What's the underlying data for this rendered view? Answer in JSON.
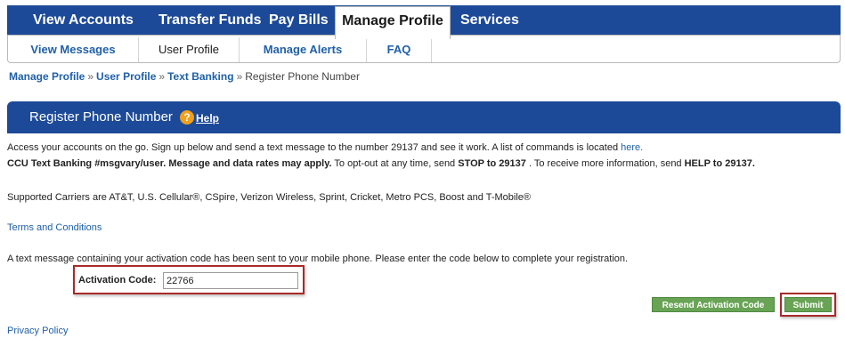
{
  "main_nav": {
    "tabs": [
      {
        "label": "View Accounts"
      },
      {
        "label": "Transfer Funds"
      },
      {
        "label": "Pay Bills"
      },
      {
        "label": "Manage Profile"
      },
      {
        "label": "Services"
      }
    ]
  },
  "sub_nav": {
    "items": [
      {
        "label": "View Messages"
      },
      {
        "label": "User Profile"
      },
      {
        "label": "Manage Alerts"
      },
      {
        "label": "FAQ"
      }
    ]
  },
  "breadcrumb": {
    "items": [
      "Manage Profile",
      "User Profile",
      "Text Banking"
    ],
    "separator": "»",
    "current": "Register Phone Number"
  },
  "panel": {
    "title": "Register Phone Number",
    "help_icon": "?",
    "help_label": "Help"
  },
  "intro": {
    "line1_text": "Access your accounts on the go. Sign up below and send a text message to the number 29137 and see it work. A list of commands is located",
    "line1_link": "here.",
    "line2_bold": "CCU Text Banking #msgvary/user. Message and data rates may apply.",
    "line2_a": " To opt-out at any time, send ",
    "line2_stop": "STOP to 29137",
    "line2_b": " . To receive more information, send ",
    "line2_help": "HELP to 29137."
  },
  "carriers_text": "Supported Carriers are AT&T, U.S. Cellular®, CSpire, Verizon Wireless, Sprint, Cricket, Metro PCS, Boost and T-Mobile®",
  "terms_link": "Terms and Conditions",
  "activation_message": "A text message containing your activation code has been sent to your mobile phone. Please enter the code below to complete your registration.",
  "activation": {
    "label": "Activation Code:",
    "value": "22766"
  },
  "buttons": {
    "resend": "Resend Activation Code",
    "submit": "Submit"
  },
  "privacy_link": "Privacy Policy",
  "colors": {
    "nav_blue": "#1d4a98",
    "link_blue": "#2060a8",
    "button_green": "#69a355",
    "highlight_red": "#a82a2a",
    "help_orange": "#f0a01c"
  }
}
